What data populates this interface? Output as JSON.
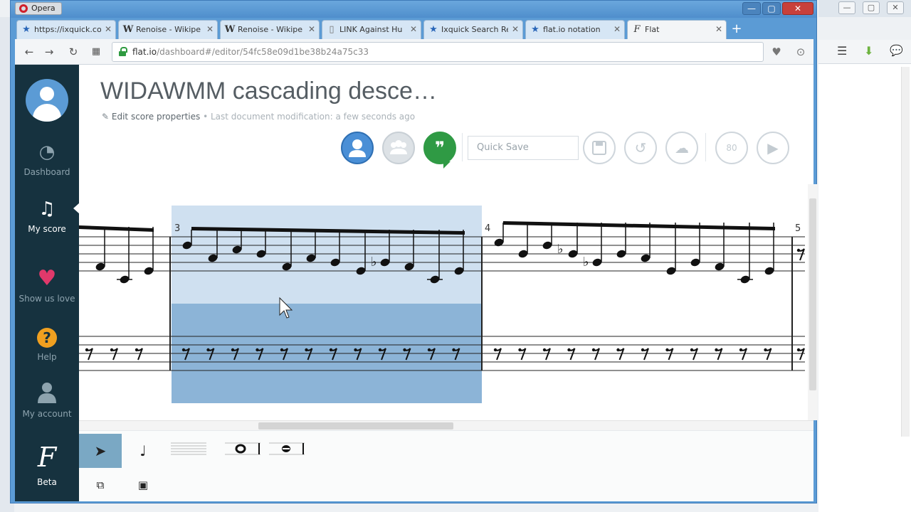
{
  "os": {
    "left_window_button": "■"
  },
  "browser": {
    "menu_label": "Opera",
    "window_controls": {
      "minimize": "—",
      "maximize": "▢",
      "close": "✕"
    },
    "tabs": [
      {
        "label": "https://ixquick.co",
        "icon": "star-icon"
      },
      {
        "label": "Renoise - Wikipe",
        "icon": "wikipedia-icon"
      },
      {
        "label": "Renoise - Wikipe",
        "icon": "wikipedia-icon"
      },
      {
        "label": "LINK Against Hu",
        "icon": "document-icon"
      },
      {
        "label": "Ixquick Search Re",
        "icon": "star-icon"
      },
      {
        "label": "flat.io notation",
        "icon": "star-icon"
      },
      {
        "label": "Flat",
        "icon": "flat-logo-icon",
        "active": true
      }
    ],
    "new_tab": "+",
    "url_host": "flat.io",
    "url_path": "/dashboard#/editor/54fc58e09d1be38b24a75c33"
  },
  "sidebar": {
    "items": [
      {
        "label": "Dashboard",
        "icon": "gauge-icon"
      },
      {
        "label": "My score",
        "icon": "music-note-icon",
        "active": true
      },
      {
        "label": "Show us love",
        "icon": "heart-icon"
      },
      {
        "label": "Help",
        "icon": "question-icon"
      },
      {
        "label": "My account",
        "icon": "user-icon"
      },
      {
        "label": "Beta",
        "icon": "flat-logo-icon"
      }
    ]
  },
  "score": {
    "title": "WIDAWMM cascading desce…",
    "edit_properties": "Edit score properties",
    "separator": "•",
    "last_modification": "Last document modification: a few seconds ago",
    "quick_save_placeholder": "Quick Save",
    "tempo": "80",
    "measure_numbers": [
      "3",
      "4",
      "5"
    ]
  },
  "colors": {
    "sidebar_bg": "#16323f",
    "accent_blue": "#4a8fd6",
    "hangouts_green": "#2f9a44",
    "heart_pink": "#e0396b",
    "help_orange": "#f0a020",
    "selection_light": "#cfe0f0",
    "selection_dark": "#8cb4d7"
  }
}
